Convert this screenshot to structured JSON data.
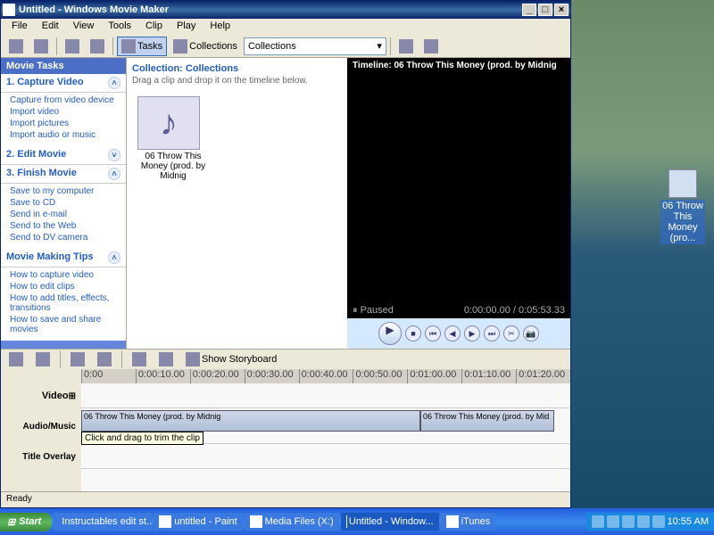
{
  "window": {
    "title": "Untitled - Windows Movie Maker",
    "menubar": [
      "File",
      "Edit",
      "View",
      "Tools",
      "Clip",
      "Play",
      "Help"
    ],
    "toolbar": {
      "tasks_label": "Tasks",
      "collections_label": "Collections",
      "combo_value": "Collections"
    }
  },
  "taskpane": {
    "header": "Movie Tasks",
    "sections": [
      {
        "title": "1. Capture Video",
        "links": [
          "Capture from video device",
          "Import video",
          "Import pictures",
          "Import audio or music"
        ]
      },
      {
        "title": "2. Edit Movie",
        "links": []
      },
      {
        "title": "3. Finish Movie",
        "links": [
          "Save to my computer",
          "Save to CD",
          "Send in e-mail",
          "Send to the Web",
          "Send to DV camera"
        ]
      },
      {
        "title": "Movie Making Tips",
        "links": [
          "How to capture video",
          "How to edit clips",
          "How to add titles, effects, transitions",
          "How to save and share movies"
        ]
      }
    ]
  },
  "collection": {
    "header": "Collection: Collections",
    "sub": "Drag a clip and drop it on the timeline below.",
    "clip_name": "06 Throw This Money (prod. by Midnig"
  },
  "preview": {
    "title": "Timeline: 06 Throw This Money (prod. by Midnig",
    "status": "Paused",
    "time": "0:00:00.00 / 0:05:53.33"
  },
  "timeline": {
    "storyboard_btn": "Show Storyboard",
    "ruler": [
      "0:00",
      "0:00:10.00",
      "0:00:20.00",
      "0:00:30.00",
      "0:00:40.00",
      "0:00:50.00",
      "0:01:00.00",
      "0:01:10.00",
      "0:01:20.00"
    ],
    "labels": {
      "video": "Video",
      "audio": "Audio/Music",
      "title": "Title Overlay"
    },
    "audio_clip1": "06 Throw This Money (prod. by Midnig",
    "audio_clip2": "06 Throw This Money (prod. by Mid",
    "tooltip": "Click and drag to trim the clip"
  },
  "statusbar": "Ready",
  "desktop_icon": "06 Throw This Money (pro...",
  "taskbar": {
    "start": "Start",
    "tasks": [
      "Instructables edit st...",
      "untitled - Paint",
      "Media Files (X:)",
      "Untitled - Window...",
      "iTunes"
    ],
    "clock": "10:55 AM"
  }
}
